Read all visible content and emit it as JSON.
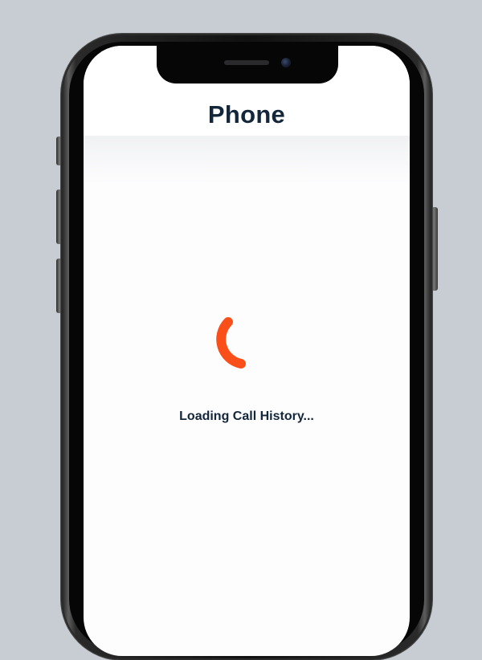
{
  "app": {
    "title": "Phone"
  },
  "status": {
    "loading_text": "Loading Call History..."
  },
  "colors": {
    "accent": "#fb4f19",
    "title_text": "#13263a",
    "screen_background": "#fdfdfe",
    "page_background": "#c8ccd3"
  },
  "icons": {
    "spinner": "loading-spinner-icon"
  }
}
